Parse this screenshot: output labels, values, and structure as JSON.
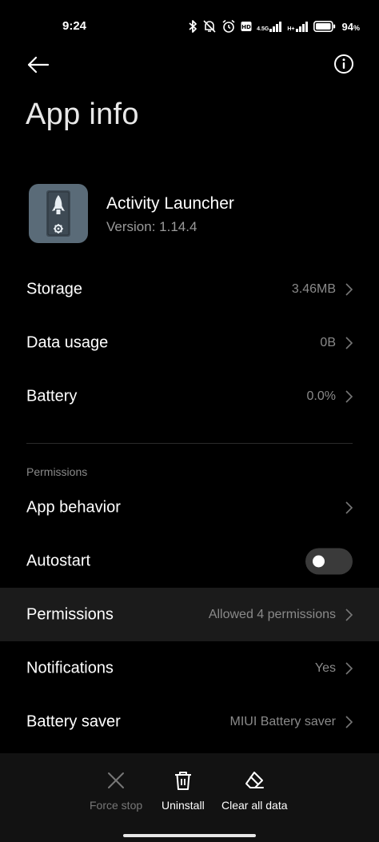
{
  "status_bar": {
    "time": "9:24",
    "battery_percent": "94",
    "battery_symbol": "%",
    "network_1": "4.5G",
    "network_2": "H+"
  },
  "header": {
    "title": "App info"
  },
  "app": {
    "name": "Activity Launcher",
    "version": "Version: 1.14.4",
    "icon_color": "#5a6b78"
  },
  "rows": {
    "storage": {
      "label": "Storage",
      "value": "3.46MB"
    },
    "data_usage": {
      "label": "Data usage",
      "value": "0B"
    },
    "battery": {
      "label": "Battery",
      "value": "0.0%"
    },
    "section_permissions": "Permissions",
    "app_behavior": {
      "label": "App behavior",
      "value": ""
    },
    "autostart": {
      "label": "Autostart",
      "enabled": false
    },
    "permissions": {
      "label": "Permissions",
      "value": "Allowed 4 permissions"
    },
    "notifications": {
      "label": "Notifications",
      "value": "Yes"
    },
    "battery_saver": {
      "label": "Battery saver",
      "value": "MIUI Battery saver"
    }
  },
  "actions": {
    "force_stop": "Force stop",
    "uninstall": "Uninstall",
    "clear_all_data": "Clear all data"
  },
  "icons": {
    "back": "arrow-left-icon",
    "info": "info-circle-icon",
    "chevron": "chevron-right-icon",
    "force_stop": "close-x-icon",
    "uninstall": "trash-icon",
    "clear_all_data": "eraser-icon"
  },
  "colors": {
    "background": "#000000",
    "secondary_text": "#8a8a8a",
    "highlight_row": "#1b1b1b",
    "bottom_bar": "#121212"
  }
}
